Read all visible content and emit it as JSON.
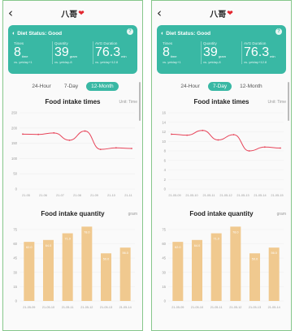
{
  "panels": [
    {
      "nav": {
        "back": "‹",
        "title": "八哥"
      },
      "card": {
        "status_label": "Diet Status",
        "status_value": "Good",
        "metrics": [
          {
            "label": "Times",
            "value": "8",
            "unit": "time",
            "compare": "vs. yetday+1"
          },
          {
            "label": "Quantity",
            "value": "39",
            "unit": "gram",
            "compare": "vs. yetday-8"
          },
          {
            "label": "AVG Duration",
            "value": "76.3",
            "unit": "min",
            "compare": "vs. yetday+12.8"
          }
        ]
      },
      "tabs": [
        "24-Hour",
        "7-Day",
        "12-Month"
      ],
      "active_tab": 2,
      "sections": {
        "times_title": "Food intake times",
        "times_unit": "Unit: Time",
        "quantity_title": "Food intake quantity",
        "quantity_unit": "gram"
      }
    },
    {
      "nav": {
        "back": "‹",
        "title": "八哥"
      },
      "card": {
        "status_label": "Diet Status",
        "status_value": "Good",
        "metrics": [
          {
            "label": "Times",
            "value": "8",
            "unit": "time",
            "compare": "vs. yetday+1"
          },
          {
            "label": "Quantity",
            "value": "39",
            "unit": "gram",
            "compare": "vs. yetday-8"
          },
          {
            "label": "AVG Duration",
            "value": "76.3",
            "unit": "min",
            "compare": "vs. yetday+12.8"
          }
        ]
      },
      "tabs": [
        "24-Hour",
        "7-Day",
        "12-Month"
      ],
      "active_tab": 1,
      "sections": {
        "times_title": "Food intake times",
        "times_unit": "Unit: Time",
        "quantity_title": "Food intake quantity",
        "quantity_unit": "gram"
      }
    }
  ],
  "chart_data": [
    {
      "type": "line",
      "panel": 0,
      "title": "Food intake times",
      "x": [
        "21-05",
        "21-06",
        "21-07",
        "21-08",
        "21-09",
        "21-10",
        "21-11"
      ],
      "ylim": [
        0,
        250
      ],
      "yticks": [
        0,
        50,
        100,
        150,
        200,
        250
      ],
      "series": [
        {
          "values": [
            180,
            179,
            184,
            160,
            190,
            130,
            135,
            133
          ]
        }
      ],
      "color": "#e7455a",
      "grid": true
    },
    {
      "type": "bar",
      "panel": 0,
      "title": "Food intake quantity",
      "categories": [
        "21-05-09",
        "21-05-10",
        "21-05-11",
        "21-05-12",
        "21-05-13",
        "21-05-14"
      ],
      "values": [
        62.0,
        64.0,
        71.0,
        78.0,
        50.0,
        56.0
      ],
      "ylim": [
        0,
        80
      ],
      "yticks": [
        0,
        15,
        30,
        45,
        60,
        75
      ],
      "color": "#f0c98f",
      "grid": true
    },
    {
      "type": "line",
      "panel": 1,
      "title": "Food intake times",
      "x": [
        "21-05-09",
        "21-05-10",
        "21-05-11",
        "21-05-12",
        "21-05-13",
        "21-05-14",
        "21-05-15"
      ],
      "ylim": [
        0,
        16
      ],
      "yticks": [
        0,
        2,
        4,
        6,
        8,
        10,
        12,
        14,
        16
      ],
      "series": [
        {
          "values": [
            11.5,
            11.3,
            12.3,
            10.3,
            11.4,
            8.0,
            8.8,
            8.6
          ]
        }
      ],
      "color": "#e7455a",
      "grid": true
    },
    {
      "type": "bar",
      "panel": 1,
      "title": "Food intake quantity",
      "categories": [
        "21-05-09",
        "21-05-10",
        "21-05-11",
        "21-05-12",
        "21-05-13",
        "21-05-14"
      ],
      "values": [
        62.0,
        64.0,
        71.0,
        78.0,
        50.0,
        56.0
      ],
      "ylim": [
        0,
        80
      ],
      "yticks": [
        0,
        15,
        30,
        45,
        60,
        75
      ],
      "color": "#f0c98f",
      "grid": true
    }
  ]
}
